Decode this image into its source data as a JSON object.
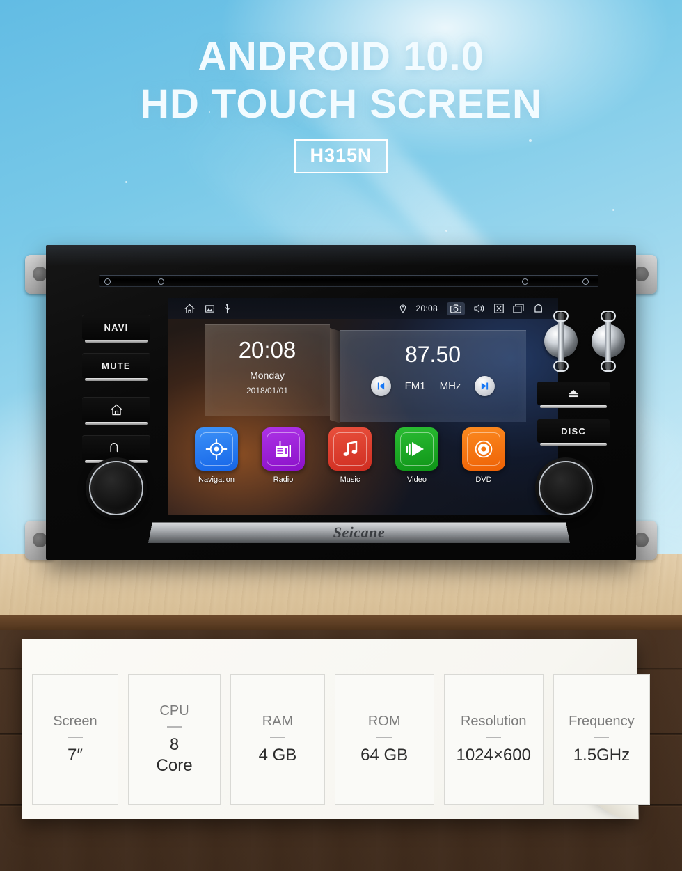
{
  "banner": {
    "line1": "ANDROID 10.0",
    "line2": "HD TOUCH SCREEN",
    "model_badge": "H315N",
    "background_color": "#79c9e8"
  },
  "head_unit": {
    "brand": "Seicane",
    "left_buttons": [
      {
        "label": "NAVI",
        "icon": null
      },
      {
        "label": "MUTE",
        "icon": null
      },
      {
        "label": "",
        "icon": "home-icon"
      },
      {
        "label": "",
        "icon": "back-icon"
      }
    ],
    "right_buttons": [
      {
        "label": "",
        "icon": "eject-icon"
      },
      {
        "label": "DISC",
        "icon": null
      }
    ],
    "screen": {
      "status_bar": {
        "left_icons": [
          "home-icon",
          "image-icon",
          "usb-icon"
        ],
        "location_icon": "location-pin-icon",
        "time": "20:08",
        "right_icons": [
          "camera-icon",
          "volume-icon",
          "close-box-icon",
          "recents-icon",
          "back-icon"
        ]
      },
      "clock_widget": {
        "time": "20:08",
        "weekday": "Monday",
        "date": "2018/01/01"
      },
      "radio_widget": {
        "frequency": "87.50",
        "band": "FM1",
        "unit": "MHz",
        "prev_icon": "skip-previous-icon",
        "next_icon": "skip-next-icon"
      },
      "apps": [
        {
          "label": "Navigation",
          "color": "#1f7bf0",
          "icon": "navigation-target-icon"
        },
        {
          "label": "Radio",
          "color": "#9b1fd8",
          "icon": "radio-icon"
        },
        {
          "label": "Music",
          "color": "#e0402e",
          "icon": "music-note-icon"
        },
        {
          "label": "Video",
          "color": "#17a820",
          "icon": "play-icon"
        },
        {
          "label": "DVD",
          "color": "#f47310",
          "icon": "disc-icon"
        }
      ]
    }
  },
  "specs": [
    {
      "label": "Screen",
      "value": "7″"
    },
    {
      "label": "CPU",
      "value": "8\nCore"
    },
    {
      "label": "RAM",
      "value": "4 GB"
    },
    {
      "label": "ROM",
      "value": "64 GB"
    },
    {
      "label": "Resolution",
      "value": "1024×600"
    },
    {
      "label": "Frequency",
      "value": "1.5GHz"
    }
  ]
}
